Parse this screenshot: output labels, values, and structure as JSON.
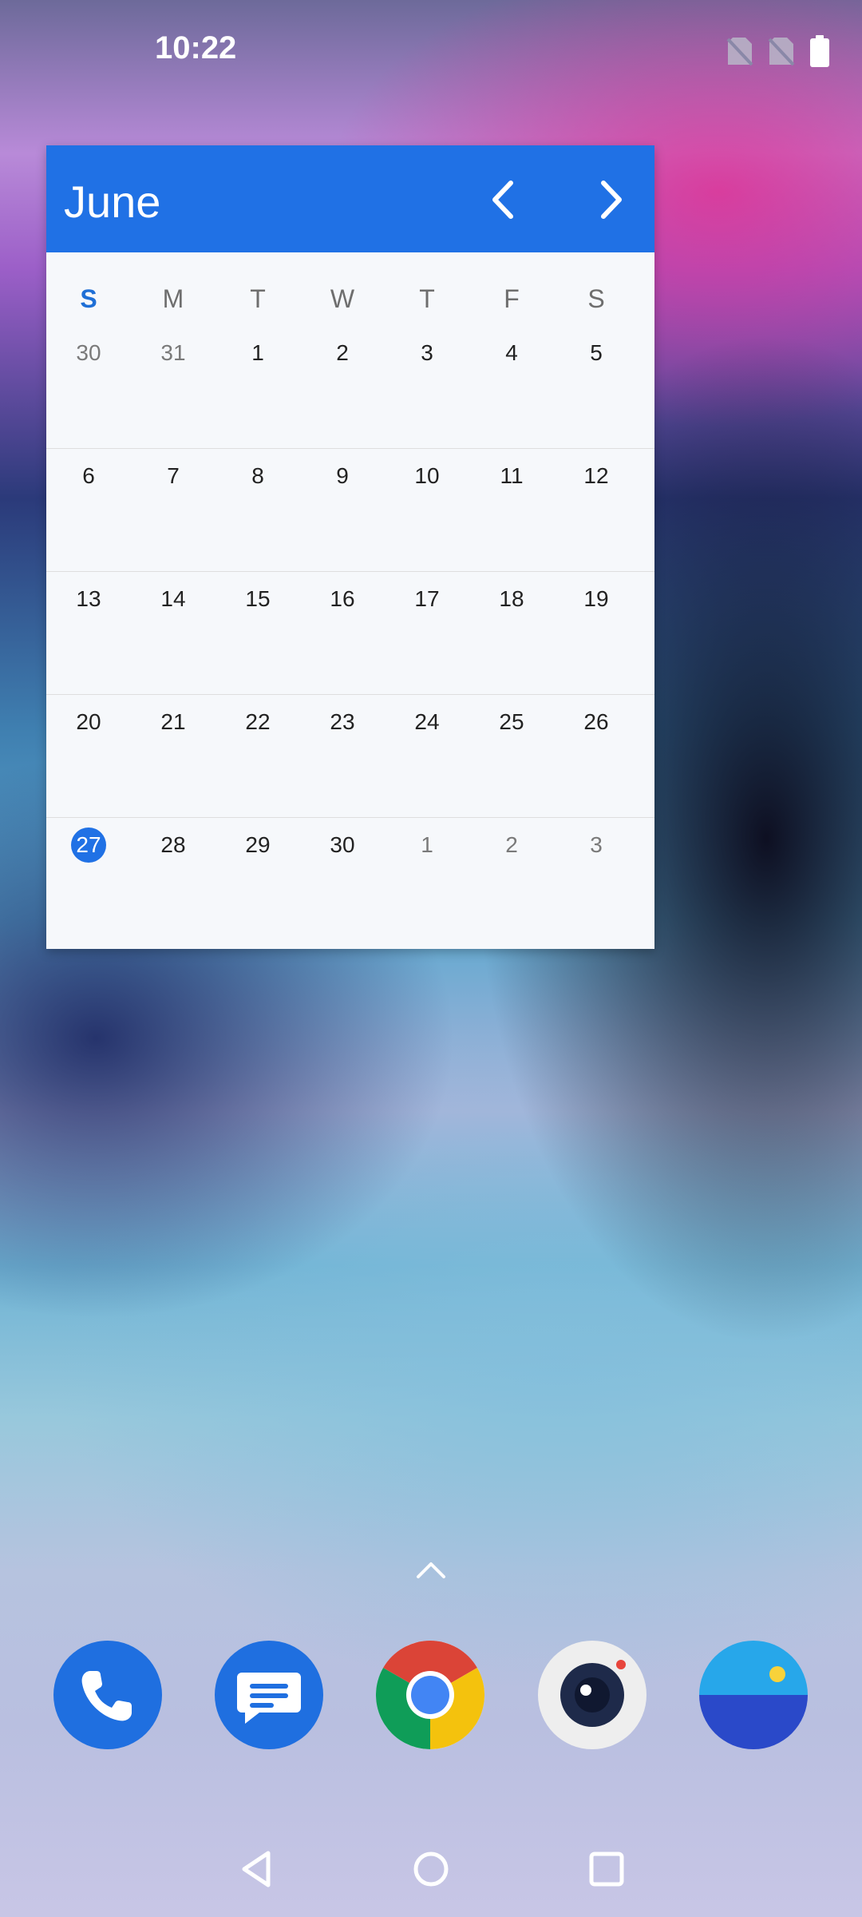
{
  "status_bar": {
    "time": "10:22",
    "icons": [
      "no-sim-icon",
      "no-sim-icon",
      "battery-full-icon"
    ]
  },
  "calendar": {
    "month": "June",
    "weekdays": [
      "S",
      "M",
      "T",
      "W",
      "T",
      "F",
      "S"
    ],
    "weeks": [
      [
        {
          "d": "30",
          "other": true
        },
        {
          "d": "31",
          "other": true
        },
        {
          "d": "1"
        },
        {
          "d": "2"
        },
        {
          "d": "3"
        },
        {
          "d": "4"
        },
        {
          "d": "5"
        }
      ],
      [
        {
          "d": "6"
        },
        {
          "d": "7"
        },
        {
          "d": "8"
        },
        {
          "d": "9"
        },
        {
          "d": "10"
        },
        {
          "d": "11"
        },
        {
          "d": "12"
        }
      ],
      [
        {
          "d": "13"
        },
        {
          "d": "14"
        },
        {
          "d": "15"
        },
        {
          "d": "16"
        },
        {
          "d": "17"
        },
        {
          "d": "18"
        },
        {
          "d": "19"
        }
      ],
      [
        {
          "d": "20"
        },
        {
          "d": "21"
        },
        {
          "d": "22"
        },
        {
          "d": "23"
        },
        {
          "d": "24"
        },
        {
          "d": "25"
        },
        {
          "d": "26"
        }
      ],
      [
        {
          "d": "27",
          "today": true
        },
        {
          "d": "28"
        },
        {
          "d": "29"
        },
        {
          "d": "30"
        },
        {
          "d": "1",
          "other": true
        },
        {
          "d": "2",
          "other": true
        },
        {
          "d": "3",
          "other": true
        }
      ]
    ],
    "accent_color": "#2071e5"
  },
  "dock": {
    "apps": [
      "phone-icon",
      "messages-icon",
      "chrome-icon",
      "camera-icon",
      "photos-icon"
    ]
  },
  "nav_bar": {
    "keys": [
      "back-icon",
      "home-icon",
      "recents-icon"
    ]
  }
}
